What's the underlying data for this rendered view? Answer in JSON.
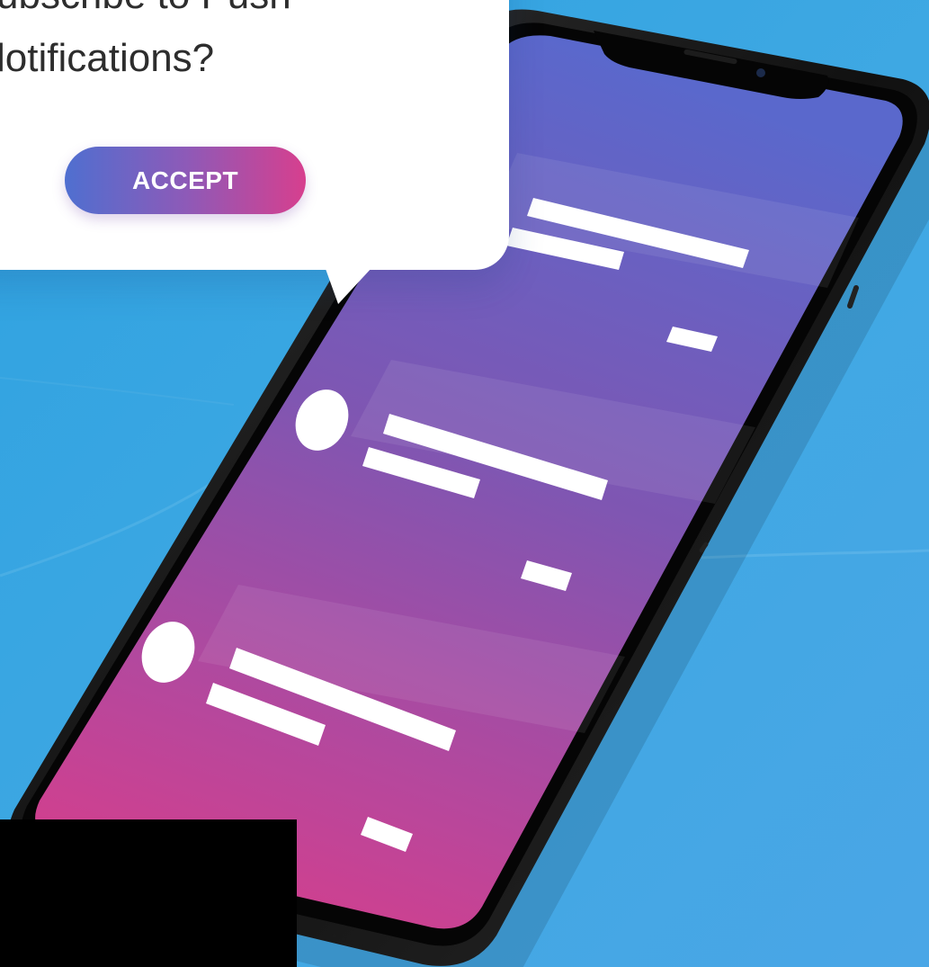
{
  "dialog": {
    "line1": "ubscribe to Push",
    "line2": "lotifications?",
    "accept_label": "ACCEPT"
  },
  "phone": {
    "screen_gradient": [
      "#5b6bd0",
      "#8a54b0",
      "#d43f8c"
    ],
    "background": "#3aa6e0"
  },
  "colors": {
    "accent_start": "#4f6fd0",
    "accent_end": "#d73f8e"
  }
}
